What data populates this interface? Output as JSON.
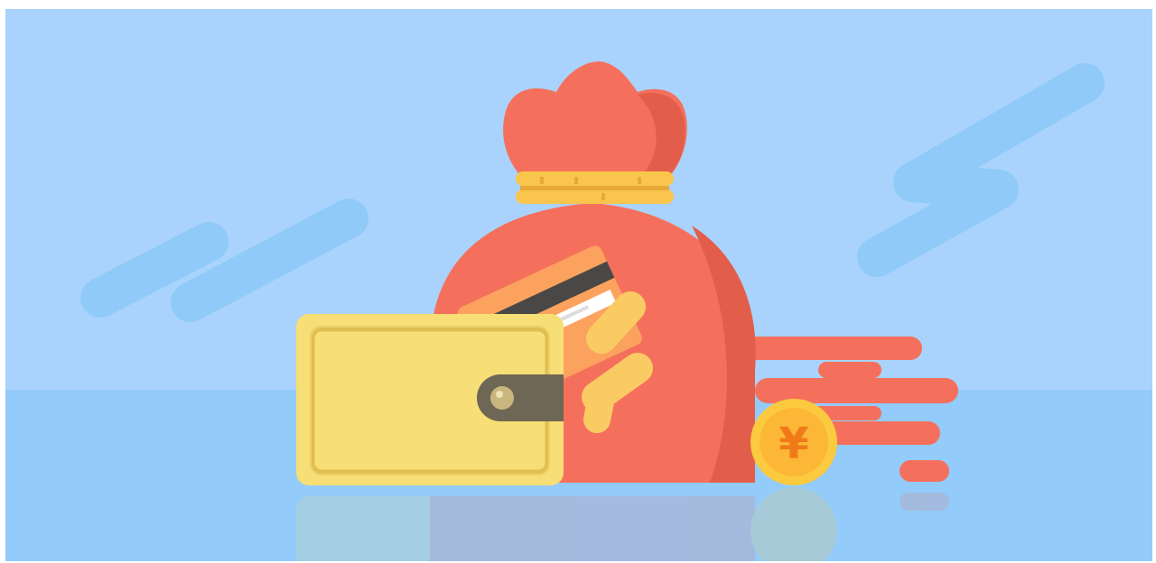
{
  "illustration": {
    "coin_symbol": "¥",
    "colors": {
      "sky": "#A9D3FD",
      "floor": "#93CBFB",
      "streak": "#8FCAF8",
      "bag": "#F5705C",
      "bag_shadow": "#E35E4A",
      "bag_tie": "#F9C54C",
      "wallet": "#F7DE76",
      "wallet_border": "#E0BF52",
      "clasp": "#6F6755",
      "card": "#FBA35E",
      "hand": "#FBCB63",
      "coin": "#FBCA3F",
      "coin_symbol": "#F07A1A"
    }
  }
}
